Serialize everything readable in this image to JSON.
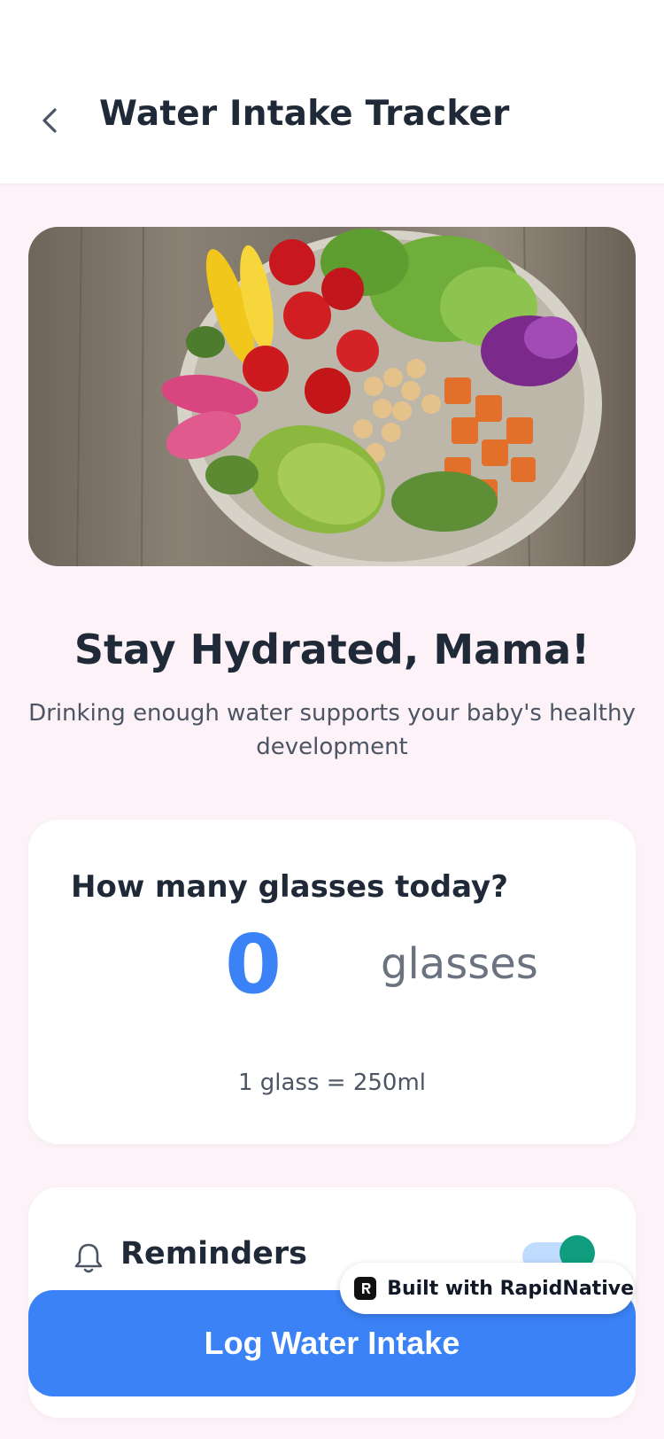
{
  "header": {
    "title": "Water Intake Tracker",
    "back_icon": "chevron-left-icon"
  },
  "hero": {
    "description": "salad-bowl-photo"
  },
  "intro": {
    "headline": "Stay Hydrated, Mama!",
    "subtext": "Drinking enough water supports your baby's healthy development"
  },
  "counter": {
    "title": "How many glasses today?",
    "value": "0",
    "unit": "glasses",
    "note": "1 glass = 250ml"
  },
  "reminders": {
    "label": "Reminders",
    "icon": "bell-icon",
    "enabled": true
  },
  "badge": {
    "text": "Built with RapidNative"
  },
  "cta": {
    "label": "Log Water Intake"
  },
  "colors": {
    "accent": "#3B82F6",
    "page_bg": "#FDF2F8",
    "toggle_knob": "#0F9D7E",
    "toggle_track": "#BFDBFE"
  }
}
